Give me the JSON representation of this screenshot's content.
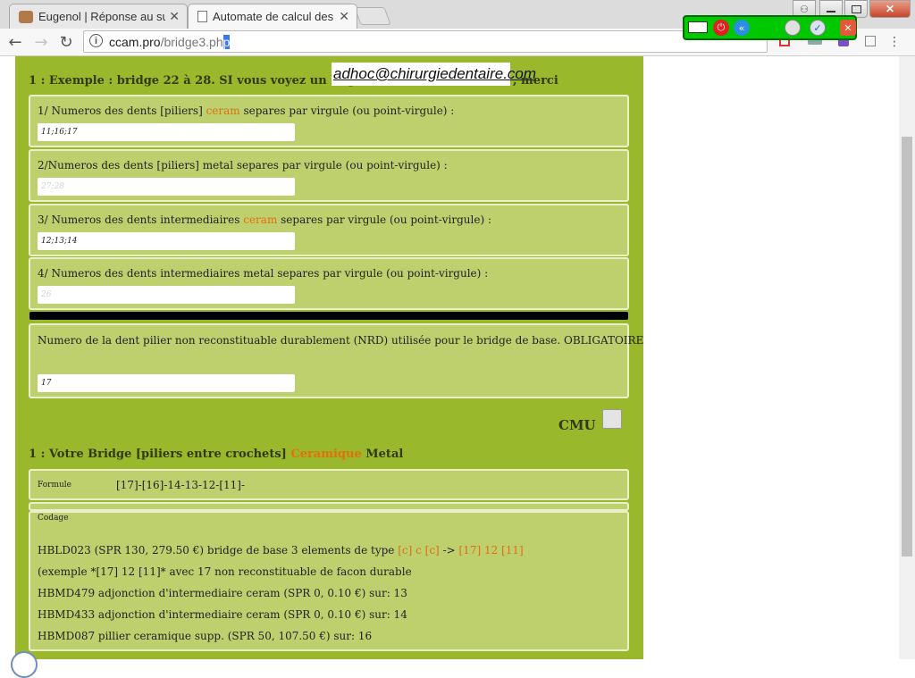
{
  "browser": {
    "tabs": [
      {
        "title": "Eugenol | Réponse au suj",
        "active": false
      },
      {
        "title": "Automate de calcul des c",
        "active": true
      }
    ],
    "url_host": "ccam.pro",
    "url_path": "/bridge3.ph",
    "url_selected": "p"
  },
  "page": {
    "intro": {
      "prefix": "1 : Exemple : bridge 22 à 28.    SI vous voyez un bug,",
      "email": "adhoc@chirurgiedentaire.com",
      "suffix": ", merci"
    },
    "fields": [
      {
        "label_a": "1/ Numeros des dents [piliers] ",
        "label_hl": "ceram",
        "label_b": " separes par virgule (ou point-virgule) :",
        "value": "11;16;17",
        "placeholder": ""
      },
      {
        "label_a": "2/Numeros des dents [piliers] metal separes par virgule (ou point-virgule) :",
        "label_hl": "",
        "label_b": "",
        "value": "",
        "placeholder": "27;28"
      },
      {
        "label_a": "3/ Numeros des dents intermediaires ",
        "label_hl": "ceram",
        "label_b": " separes par virgule (ou point-virgule) :",
        "value": "12;13;14",
        "placeholder": ""
      },
      {
        "label_a": "4/ Numeros des dents intermediaires metal separes par virgule (ou point-virgule) :",
        "label_hl": "",
        "label_b": "",
        "value": "",
        "placeholder": "26"
      }
    ],
    "nrd": {
      "label": "Numero de la dent pilier non reconstituable durablement (NRD) utilisée pour le bridge de base. OBLIGATOIRE",
      "value": "17"
    },
    "cmu_label": "CMU",
    "cmu_checked": false,
    "result_heading": {
      "prefix": "1 : Votre Bridge [piliers entre crochets] ",
      "ceramique": "Ceramique",
      "metal": " Metal"
    },
    "formule": {
      "label": "Formule",
      "value": "[17]-[16]-14-13-12-[11]-"
    },
    "codage": {
      "label": "Codage",
      "line1_a": "HBLD023 (SPR 130, 279.50 €) bridge de base 3 elements de type ",
      "line1_b": "[c] c [c]",
      "line1_c": " -> ",
      "line1_d": "[17] 12 [11]",
      "line2": "(exemple *[17] 12 [11]*    avec 17 non reconstituable de facon durable",
      "line3": "HBMD479 adjonction d'intermediaire ceram (SPR 0, 0.10 €) sur: 13",
      "line4": "HBMD433 adjonction d'intermediaire ceram (SPR 0, 0.10 €) sur: 14",
      "line5": "HBMD087 pillier ceramique supp. (SPR 50, 107.50 €) sur: 16"
    }
  },
  "colors": {
    "page_green": "#9ab82b",
    "panel_green": "#bdd06d",
    "highlight_orange": "#e07010"
  }
}
